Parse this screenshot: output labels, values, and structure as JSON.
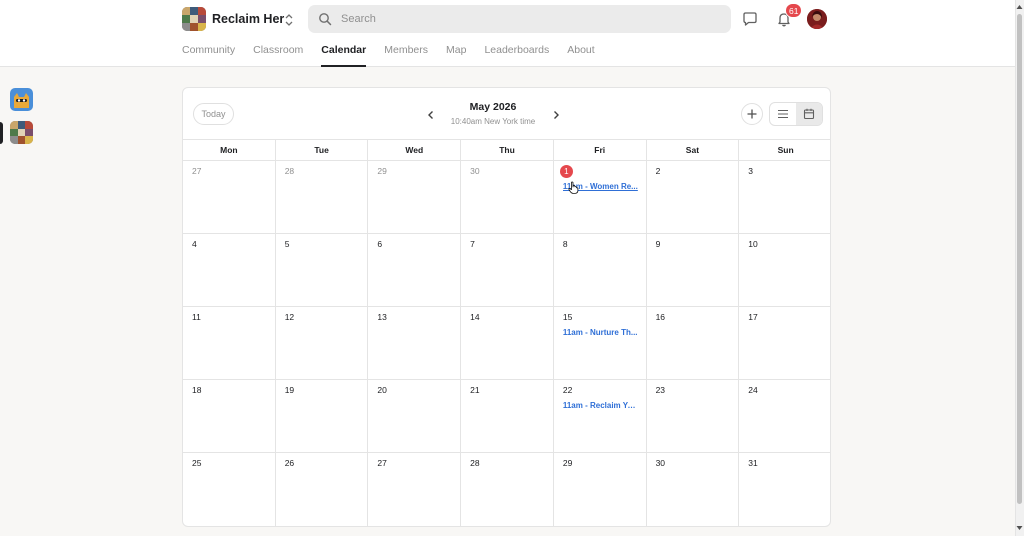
{
  "group": {
    "name": "Reclaim Her"
  },
  "search": {
    "placeholder": "Search"
  },
  "notifications": {
    "count": "61"
  },
  "nav": {
    "tabs": [
      {
        "label": "Community"
      },
      {
        "label": "Classroom"
      },
      {
        "label": "Calendar"
      },
      {
        "label": "Members"
      },
      {
        "label": "Map"
      },
      {
        "label": "Leaderboards"
      },
      {
        "label": "About"
      }
    ],
    "active": "Calendar"
  },
  "calendar": {
    "today_label": "Today",
    "month": "May 2026",
    "timezone": "10:40am New York time",
    "weekdays": [
      "Mon",
      "Tue",
      "Wed",
      "Thu",
      "Fri",
      "Sat",
      "Sun"
    ],
    "weeks": [
      [
        {
          "day": "27",
          "muted": true
        },
        {
          "day": "28",
          "muted": true
        },
        {
          "day": "29",
          "muted": true
        },
        {
          "day": "30",
          "muted": true
        },
        {
          "day": "1",
          "today": true,
          "event": "11am - Women Re..."
        },
        {
          "day": "2"
        },
        {
          "day": "3"
        }
      ],
      [
        {
          "day": "4"
        },
        {
          "day": "5"
        },
        {
          "day": "6"
        },
        {
          "day": "7"
        },
        {
          "day": "8"
        },
        {
          "day": "9"
        },
        {
          "day": "10"
        }
      ],
      [
        {
          "day": "11"
        },
        {
          "day": "12"
        },
        {
          "day": "13"
        },
        {
          "day": "14"
        },
        {
          "day": "15",
          "event": "11am - Nurture Th..."
        },
        {
          "day": "16"
        },
        {
          "day": "17"
        }
      ],
      [
        {
          "day": "18"
        },
        {
          "day": "19"
        },
        {
          "day": "20"
        },
        {
          "day": "21"
        },
        {
          "day": "22",
          "event": "11am - Reclaim Yo..."
        },
        {
          "day": "23"
        },
        {
          "day": "24"
        }
      ],
      [
        {
          "day": "25"
        },
        {
          "day": "26"
        },
        {
          "day": "27"
        },
        {
          "day": "28"
        },
        {
          "day": "29"
        },
        {
          "day": "30"
        },
        {
          "day": "31"
        }
      ]
    ]
  },
  "colors": {
    "accent_blue": "#2f6fd6",
    "badge_red": "#e5484d",
    "text": "#202124",
    "muted": "#909090"
  },
  "icons": {
    "search": "search-icon",
    "switch": "chevron-updown-icon",
    "chat": "chat-icon",
    "bell": "bell-icon",
    "prev": "chevron-left-icon",
    "next": "chevron-right-icon",
    "add": "plus-icon",
    "list": "list-view-icon",
    "calendar": "calendar-view-icon"
  }
}
